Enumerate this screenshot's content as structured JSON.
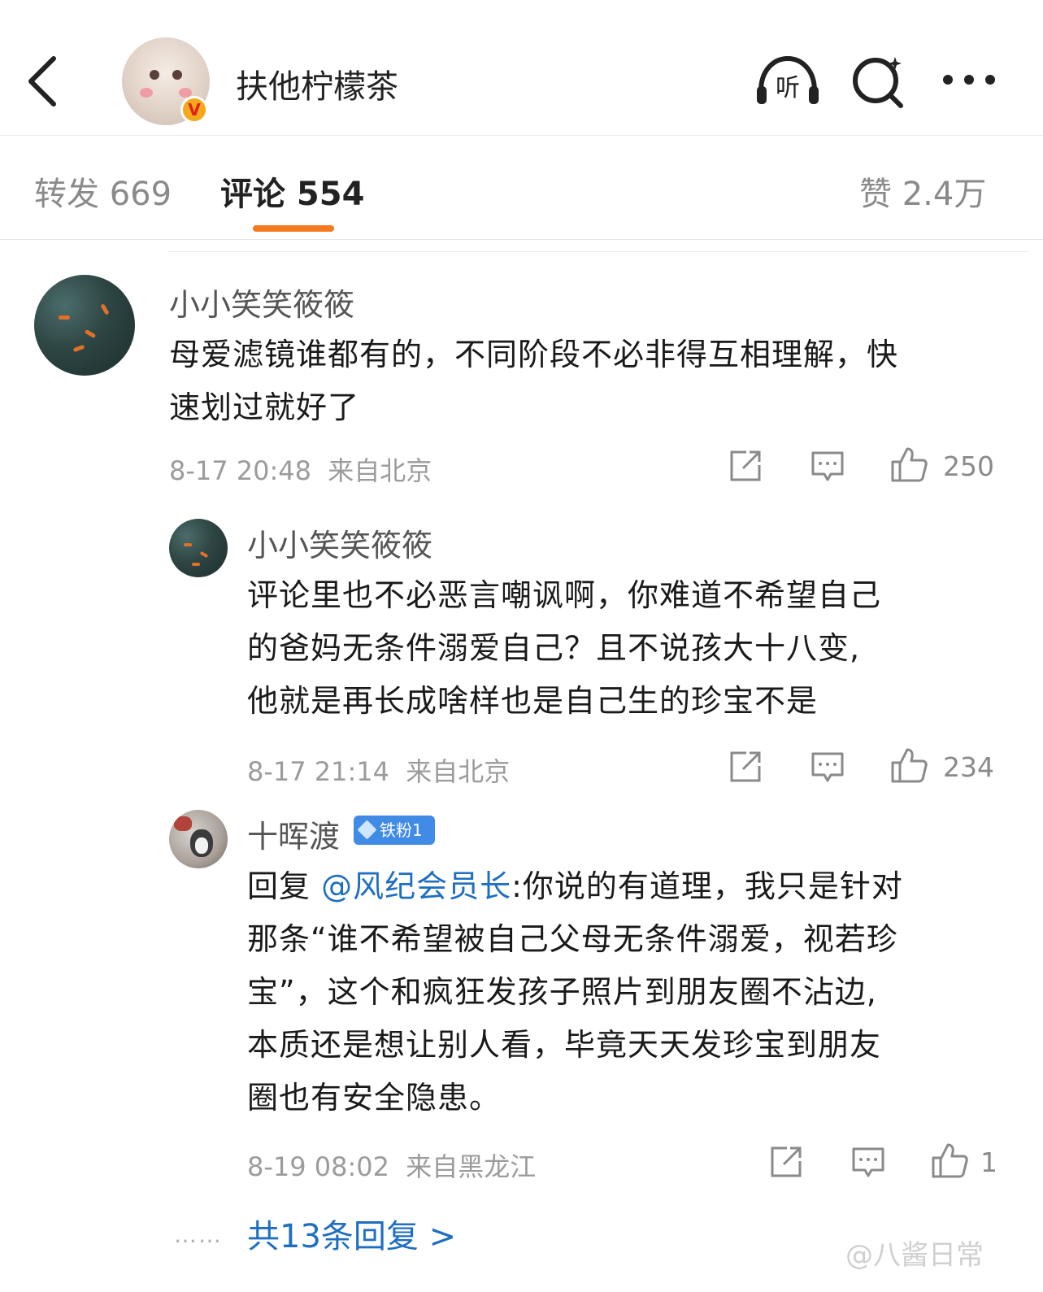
{
  "header": {
    "title": "扶他柠檬茶",
    "verified_mark": "V",
    "icons": [
      "back-arrow-icon",
      "listen-icon",
      "search-icon",
      "more-icon"
    ],
    "listen_label": "听"
  },
  "tabs": {
    "repost": "转发 669",
    "comments": "评论 554",
    "likes": "赞 2.4万",
    "accent_color": "#f47a20"
  },
  "comments": [
    {
      "user": "小小笑笑筱筱",
      "text_line1": "母爱滤镜谁都有的，不同阶段不必非得互相理解，快",
      "text_line2": "速划过就好了",
      "time": "8-17 20:48",
      "location": "来自北京",
      "likes": "250"
    },
    {
      "user": "小小笑笑筱筱",
      "text_line1": "评论里也不必恶言嘲讽啊，你难道不希望自己",
      "text_line2": "的爸妈无条件溺爱自己？且不说孩大十八变,",
      "text_line3": "他就是再长成啥样也是自己生的珍宝不是",
      "time": "8-17 21:14",
      "location": "来自北京",
      "likes": "234"
    },
    {
      "user": "十晖渡",
      "fan_badge": "铁粉1",
      "reply_prefix": "回复 ",
      "mention": "@风纪会员长",
      "text_line1": ":你说的有道理，我只是针对",
      "text_line2": "那条“谁不希望被自己父母无条件溺爱，视若珍",
      "text_line3": "宝”，这个和疯狂发孩子照片到朋友圈不沾边,",
      "text_line4": "本质还是想让别人看，毕竟天天发珍宝到朋友",
      "text_line5": "圈也有安全隐患。",
      "time": "8-19 08:02",
      "location": "来自黑龙江",
      "likes": "1"
    }
  ],
  "footer": {
    "dots": "……",
    "more_replies": "共13条回复 >",
    "watermark": "@八酱日常",
    "link_color": "#1f6fc0"
  }
}
